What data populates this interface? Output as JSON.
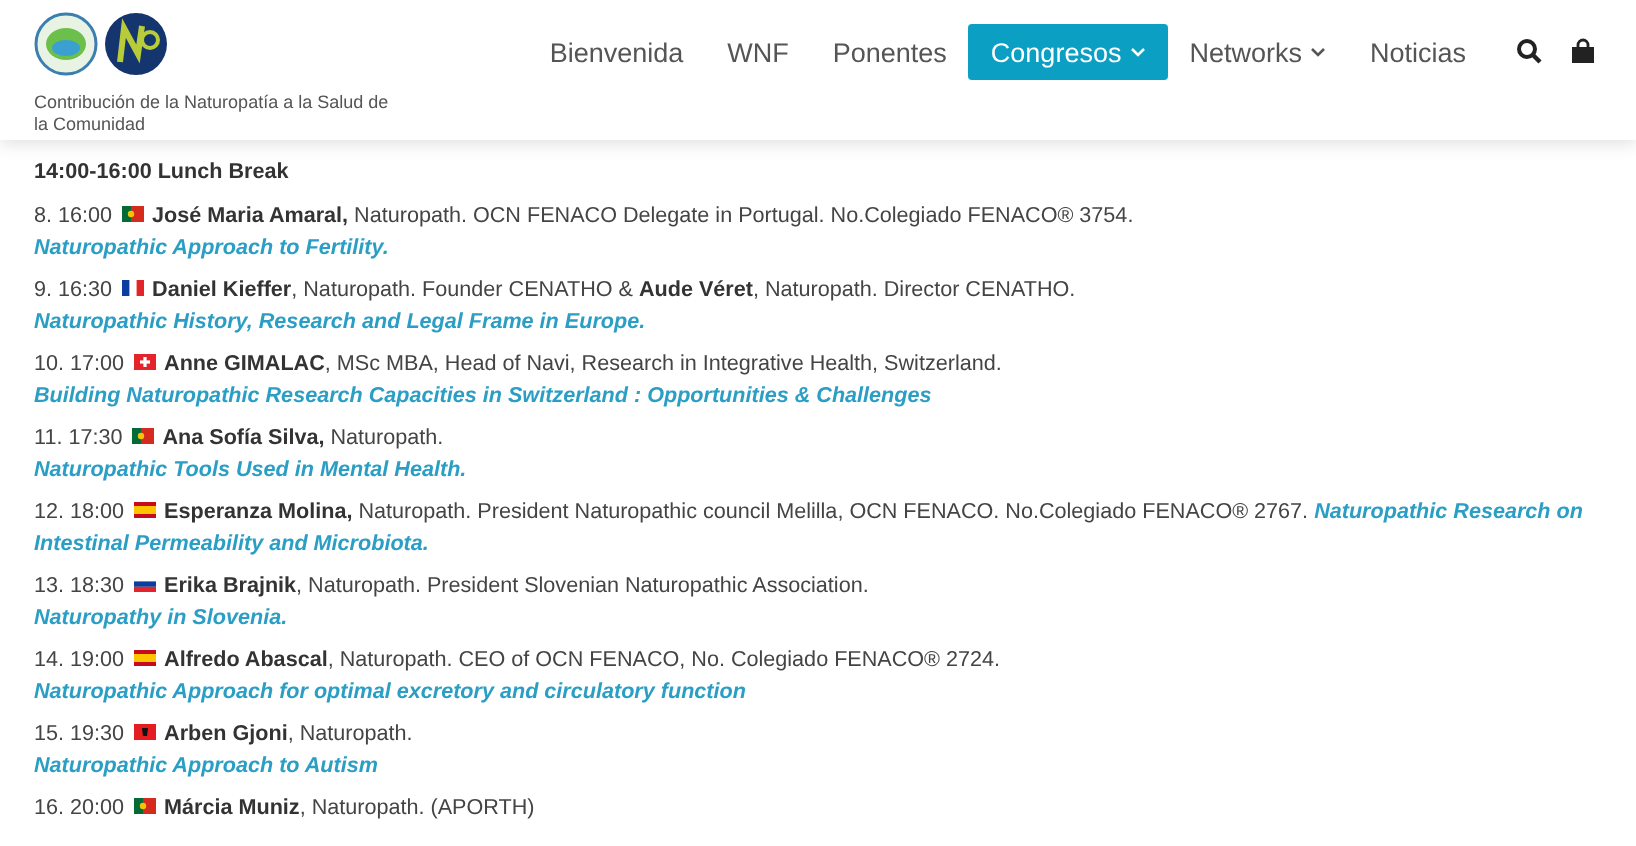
{
  "header": {
    "tagline": "Contribución de la Naturopatía a la Salud de la Comunidad",
    "nav": [
      {
        "label": "Bienvenida",
        "selected": false,
        "dropdown": false
      },
      {
        "label": "WNF",
        "selected": false,
        "dropdown": false
      },
      {
        "label": "Ponentes",
        "selected": false,
        "dropdown": false
      },
      {
        "label": "Congresos",
        "selected": true,
        "dropdown": true
      },
      {
        "label": "Networks",
        "selected": false,
        "dropdown": true
      },
      {
        "label": "Noticias",
        "selected": false,
        "dropdown": false
      }
    ]
  },
  "program": {
    "heading": "14:00-16:00 Lunch Break",
    "sessions": [
      {
        "slot": "8. 16:00",
        "flag": {
          "kind": "pt"
        },
        "speaker": "**José Maria Amaral,** Naturopath. OCN FENACO Delegate in Portugal. No.Colegiado FENACO® 3754.",
        "talk": "Naturopathic Approach to Fertility."
      },
      {
        "slot": "9. 16:30",
        "flag": {
          "kind": "fr"
        },
        "speaker": "**Daniel Kieffer**, Naturopath. Founder CENATHO & **Aude Véret**, Naturopath. Director CENATHO.",
        "talk": "Naturopathic History, Research and Legal Frame in Europe."
      },
      {
        "slot": "10. 17:00",
        "flag": {
          "kind": "ch"
        },
        "speaker": "**Anne GIMALAC**, MSc MBA, Head of Navi, Research in Integrative Health, Switzerland.",
        "talk": "Building Naturopathic Research Capacities in Switzerland : Opportunities & Challenges"
      },
      {
        "slot": "11. 17:30",
        "flag": {
          "kind": "pt"
        },
        "speaker": "**Ana Sofía Silva,** Naturopath.",
        "talk": "Naturopathic Tools Used in Mental Health."
      },
      {
        "slot": "12. 18:00",
        "flag": {
          "kind": "es"
        },
        "speaker": "**Esperanza Molina,** Naturopath. President Naturopathic council Melilla, OCN FENACO. No.Colegiado FENACO® 2767.",
        "talk_start": "Naturopathic Research on",
        "talk": "Intestinal Permeability and Microbiota."
      },
      {
        "slot": "13. 18:30",
        "flag": {
          "kind": "si"
        },
        "speaker": "**Erika Brajnik**, Naturopath. President Slovenian Naturopathic Association.",
        "talk": "Naturopathy in Slovenia."
      },
      {
        "slot": "14. 19:00",
        "flag": {
          "kind": "es"
        },
        "speaker": "**Alfredo Abascal**, Naturopath. CEO of OCN FENACO, No. Colegiado FENACO® 2724.",
        "talk": "Naturopathic Approach for optimal excretory and circulatory function"
      },
      {
        "slot": "15. 19:30",
        "flag": {
          "kind": "al"
        },
        "speaker": "**Arben Gjoni**, Naturopath.",
        "talk": "Naturopathic Approach to Autism"
      },
      {
        "slot": "16. 20:00",
        "flag": {
          "kind": "pt"
        },
        "speaker": "**Márcia Muniz**, Naturopath. (APORTH)"
      }
    ]
  }
}
